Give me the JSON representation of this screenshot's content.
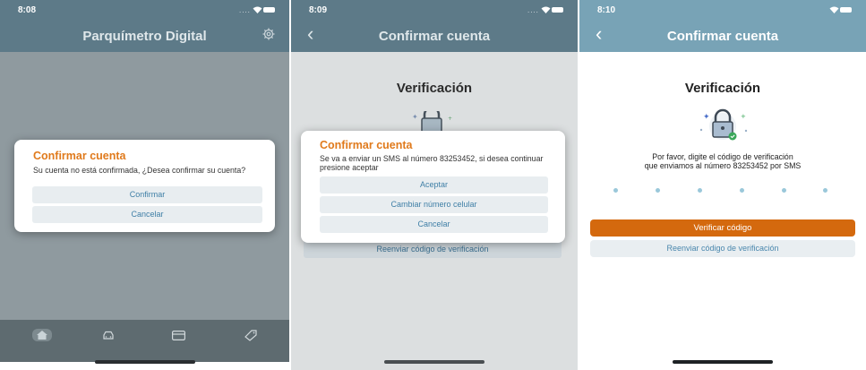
{
  "colors": {
    "header": "#5b7c8c",
    "header_active": "#78a3b6",
    "accent_orange": "#e07a1c",
    "verify_button": "#d4690e",
    "link_blue": "#3f7fa6"
  },
  "screen1": {
    "time": "8:08",
    "nav_title": "Parquímetro Digital",
    "nav_icon": "gear-icon",
    "dialog": {
      "title": "Confirmar cuenta",
      "message": "Su cuenta no está confirmada, ¿Desea confirmar su cuenta?",
      "confirm": "Confirmar",
      "cancel": "Cancelar"
    },
    "tabs": [
      "home-icon",
      "car-icon",
      "card-icon",
      "tag-icon"
    ]
  },
  "screen2": {
    "time": "8:09",
    "nav_title": "Confirmar cuenta",
    "content_title": "Verificación",
    "resend_label": "Reenviar código de verificación",
    "dialog": {
      "title": "Confirmar cuenta",
      "message": "Se va a enviar un SMS al número 83253452, si desea continuar presione aceptar",
      "accept": "Aceptar",
      "change": "Cambiar número celular",
      "cancel": "Cancelar"
    }
  },
  "screen3": {
    "time": "8:10",
    "nav_title": "Confirmar cuenta",
    "content_title": "Verificación",
    "instructions": [
      "Por favor, digite el código de verificación",
      "que enviamos al número 83253452 por SMS"
    ],
    "verify_label": "Verificar código",
    "resend_label": "Reenviar código de verificación"
  }
}
